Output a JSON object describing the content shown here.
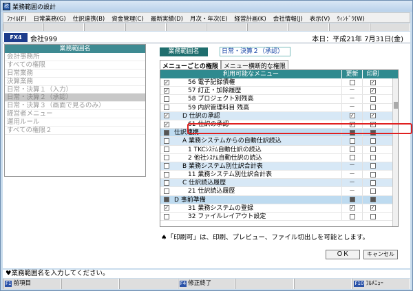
{
  "window": {
    "title": "業務範囲の設計"
  },
  "menubar": [
    "ﾌｧｲﾙ(F)",
    "日常業務(G)",
    "仕訳連携(B)",
    "資金管理(C)",
    "最新実績(D)",
    "月次・年次(E)",
    "経営計画(K)",
    "会社情報(J)",
    "表示(V)",
    "ｳｨﾝﾄﾞｳ(W)"
  ],
  "header": {
    "badge": "FX4",
    "company": "会社999",
    "date": "本日：平成21年 7月31日(金)"
  },
  "left": {
    "header": "業務範囲名",
    "items": [
      "会計事務所",
      "すべての権限",
      "日常業務",
      "決算業務",
      "日常・決算１（入力）",
      "日常・決算２（承認）",
      "日常・決算３（画面で見るのみ）",
      "経営者メニュー",
      "運用ルール",
      "すべての権限２"
    ],
    "selected_index": 5
  },
  "range": {
    "label": "業務範囲名",
    "value": "日常・決算２（承認）"
  },
  "tabs": [
    "メニューごとの権限",
    "メニュー横断的な権限"
  ],
  "grid": {
    "headers": [
      "利用可能なメニュー",
      "更新",
      "印刷"
    ],
    "rows": [
      {
        "label": "56 電子記録債権",
        "cb": "chk",
        "upd": "box",
        "prt": "chk",
        "type": ""
      },
      {
        "label": "57 訂正・加除履歴",
        "cb": "chk",
        "upd": "dash",
        "prt": "chk",
        "type": ""
      },
      {
        "label": "58 プロジェクト別残高",
        "cb": "box",
        "upd": "dash",
        "prt": "box",
        "type": ""
      },
      {
        "label": "59 内訳管理科目 残高",
        "cb": "box",
        "upd": "dash",
        "prt": "box",
        "type": ""
      },
      {
        "label": "D 仕訳の承認",
        "cb": "chk",
        "upd": "chk",
        "prt": "chk",
        "type": "grp2"
      },
      {
        "label": "61 仕訳の承認",
        "cb": "chk",
        "upd": "chk",
        "prt": "chk",
        "type": ""
      },
      {
        "label": "仕訳連携",
        "cb": "fill",
        "upd": "fill",
        "prt": "fill",
        "type": "grp"
      },
      {
        "label": "A 業務システムからの自動仕訳読込",
        "cb": "box",
        "upd": "box",
        "prt": "box",
        "type": "grp2"
      },
      {
        "label": "1 TKCｼｽﾃﾑ自動仕訳の読込",
        "cb": "box",
        "upd": "box",
        "prt": "box",
        "type": ""
      },
      {
        "label": "2 他社ｼｽﾃﾑ自動仕訳の読込",
        "cb": "box",
        "upd": "box",
        "prt": "box",
        "type": ""
      },
      {
        "label": "B 業務システム別仕訳合計表",
        "cb": "box",
        "upd": "dash",
        "prt": "box",
        "type": "grp2"
      },
      {
        "label": "11 業務システム別仕訳合計表",
        "cb": "box",
        "upd": "dash",
        "prt": "box",
        "type": ""
      },
      {
        "label": "C 仕訳読込履歴",
        "cb": "box",
        "upd": "dash",
        "prt": "box",
        "type": "grp2"
      },
      {
        "label": "21 仕訳読込履歴",
        "cb": "box",
        "upd": "dash",
        "prt": "box",
        "type": ""
      },
      {
        "label": "D 事前準備",
        "cb": "fill",
        "upd": "fill",
        "prt": "fill",
        "type": "grp"
      },
      {
        "label": "31 業務システムの登録",
        "cb": "chk",
        "upd": "chk",
        "prt": "chk",
        "type": ""
      },
      {
        "label": "32 ファイルレイアウト設定",
        "cb": "box",
        "upd": "box",
        "prt": "box",
        "type": ""
      }
    ]
  },
  "note": "♠「印刷可」は、印刷、プレビュー、ファイル切出しを可能とします。",
  "buttons": {
    "ok": "ＯＫ",
    "cancel": "キャンセル"
  },
  "status": "♥業務範囲名を入力してください。",
  "fkeys": [
    {
      "k": "F1",
      "t": "前項目"
    },
    {
      "k": "",
      "t": ""
    },
    {
      "k": "",
      "t": ""
    },
    {
      "k": "F4",
      "t": "修正終了"
    },
    {
      "k": "",
      "t": ""
    },
    {
      "k": "",
      "t": ""
    },
    {
      "k": "F10",
      "t": "ﾌﾙﾒﾆｭｰ"
    }
  ]
}
